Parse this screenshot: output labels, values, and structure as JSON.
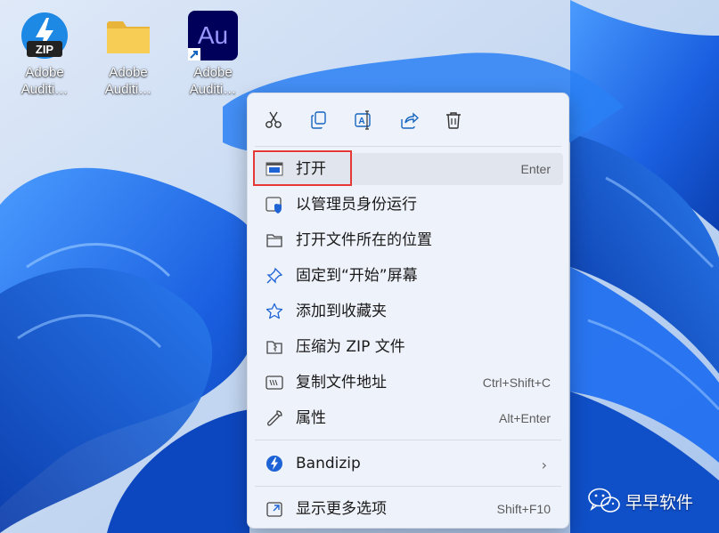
{
  "desktop": {
    "icons": [
      {
        "name": "Adobe Auditi…",
        "line1": "Adobe",
        "line2": "Auditi…",
        "type": "zip",
        "badge": "ZIP"
      },
      {
        "name": "Adobe Auditi…",
        "line1": "Adobe",
        "line2": "Auditi…",
        "type": "folder"
      },
      {
        "name": "Adobe Auditi…",
        "line1": "Adobe",
        "line2": "Auditi…",
        "type": "shortcut",
        "badge": "Au"
      }
    ]
  },
  "context_menu": {
    "toolbar": [
      {
        "icon": "cut-icon"
      },
      {
        "icon": "copy-icon"
      },
      {
        "icon": "rename-icon"
      },
      {
        "icon": "share-icon"
      },
      {
        "icon": "delete-icon"
      }
    ],
    "items": [
      {
        "label": "打开",
        "shortcut": "Enter",
        "icon": "open-icon",
        "highlighted": true
      },
      {
        "label": "以管理员身份运行",
        "shortcut": "",
        "icon": "run-as-admin-icon"
      },
      {
        "label": "打开文件所在的位置",
        "shortcut": "",
        "icon": "folder-icon"
      },
      {
        "label": "固定到“开始”屏幕",
        "shortcut": "",
        "icon": "pin-icon"
      },
      {
        "label": "添加到收藏夹",
        "shortcut": "",
        "icon": "star-icon"
      },
      {
        "label": "压缩为 ZIP 文件",
        "shortcut": "",
        "icon": "zip-folder-icon"
      },
      {
        "label": "复制文件地址",
        "shortcut": "Ctrl+Shift+C",
        "icon": "copy-path-icon"
      },
      {
        "label": "属性",
        "shortcut": "Alt+Enter",
        "icon": "wrench-icon"
      },
      {
        "label": "Bandizip",
        "shortcut": "",
        "icon": "bandizip-icon",
        "submenu": true
      },
      {
        "label": "显示更多选项",
        "shortcut": "Shift+F10",
        "icon": "more-options-icon"
      }
    ]
  },
  "watermark": {
    "text": "早早软件"
  },
  "colors": {
    "accent": "#005fb8",
    "highlight_border": "#e53935",
    "wallpaper": "#1f6fe0"
  }
}
